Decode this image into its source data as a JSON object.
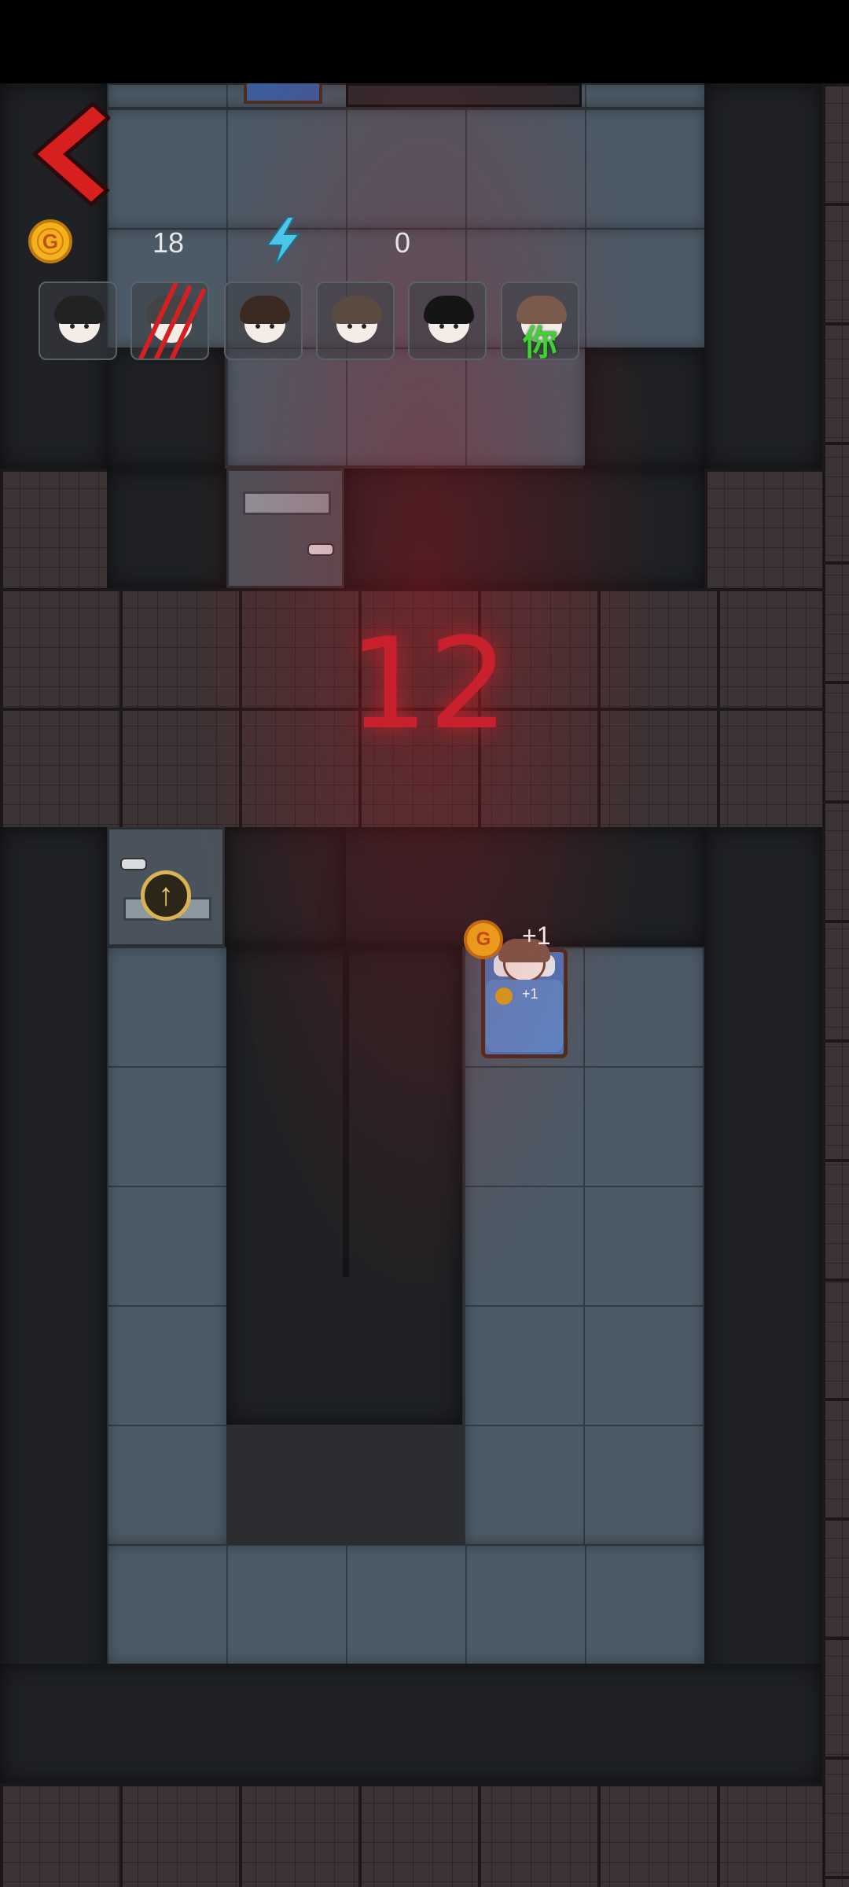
{
  "hud": {
    "coins": "18",
    "energy": "0",
    "coin_symbol": "G"
  },
  "countdown": "12",
  "players": [
    {
      "id": "player-1",
      "status": "alive"
    },
    {
      "id": "player-2",
      "status": "eliminated"
    },
    {
      "id": "player-3",
      "status": "alive"
    },
    {
      "id": "player-4",
      "status": "alive"
    },
    {
      "id": "player-5",
      "status": "alive"
    },
    {
      "id": "player-6",
      "status": "self",
      "label": "你"
    }
  ],
  "bed": {
    "coin_symbol": "G",
    "income_label": "+1",
    "small_income_label": "+1"
  },
  "colors": {
    "countdown": "#c8202c",
    "back_arrow": "#d71f1f",
    "coin": "#f2b21c",
    "energy": "#4cc6e8",
    "you_label": "#3fd233",
    "floor": "#4b5a66"
  },
  "icons": [
    "back-arrow-icon",
    "gold-coin-icon",
    "lightning-icon",
    "upgrade-arrow-icon",
    "claw-marks-icon"
  ]
}
